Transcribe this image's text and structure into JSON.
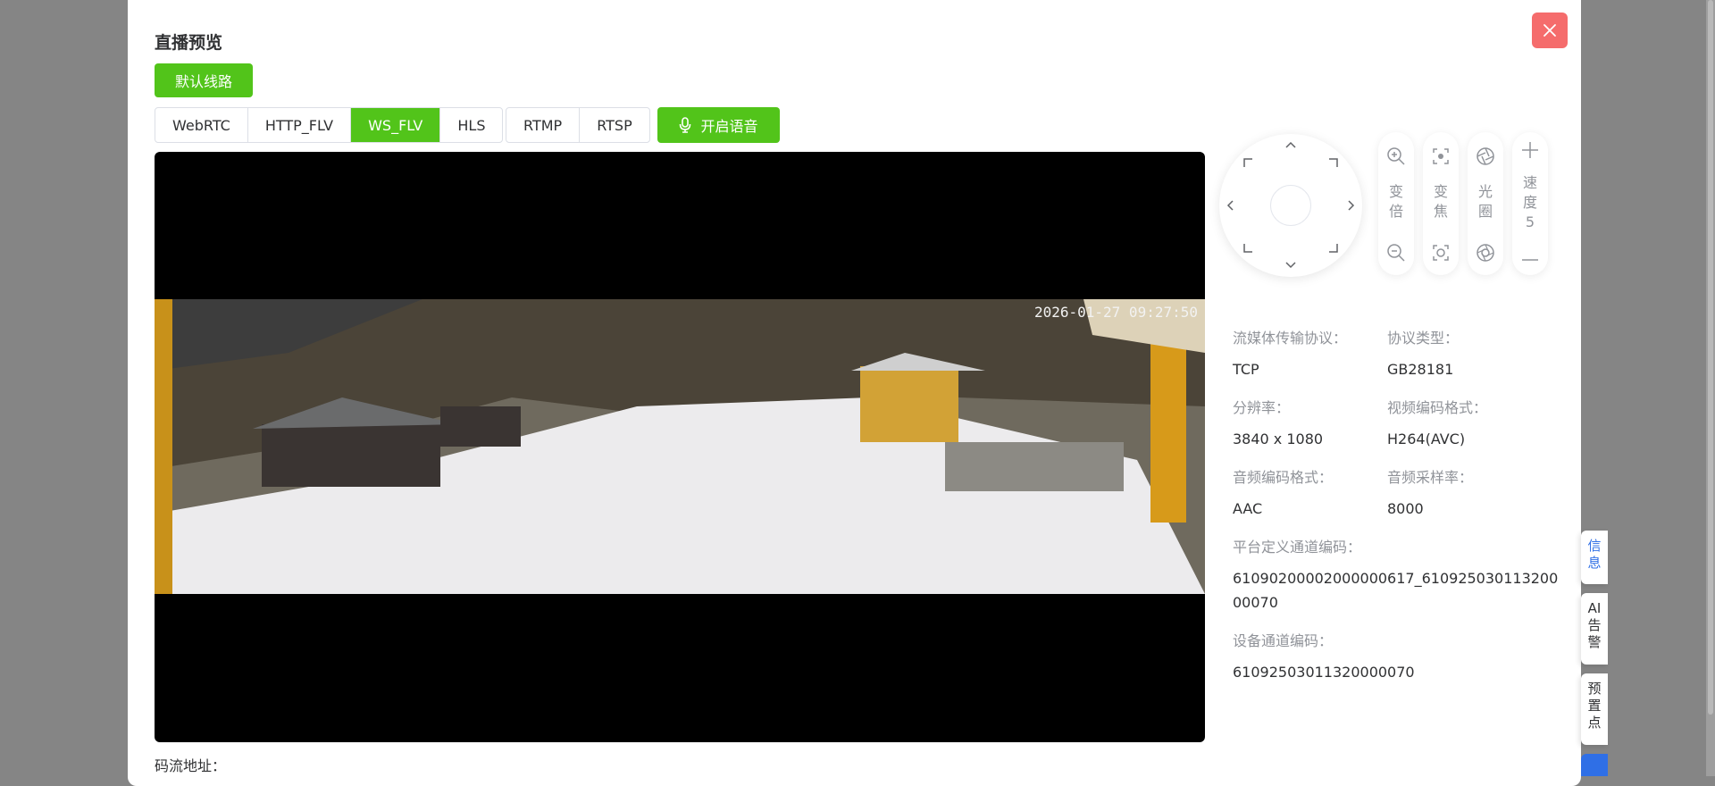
{
  "dialog": {
    "title": "直播预览"
  },
  "route": {
    "label": "默认线路"
  },
  "protocols": [
    {
      "label": "WebRTC",
      "active": false
    },
    {
      "label": "HTTP_FLV",
      "active": false
    },
    {
      "label": "WS_FLV",
      "active": true
    },
    {
      "label": "HLS",
      "active": false
    }
  ],
  "protocols2": [
    {
      "label": "RTMP"
    },
    {
      "label": "RTSP"
    }
  ],
  "voice": {
    "label": "开启语音",
    "icon": "microphone-icon"
  },
  "video": {
    "timestamp": "2026-01-27 09:27:50"
  },
  "stream_address_label": "码流地址：",
  "ptz": {
    "zoom_label": "变倍",
    "focus_label": "变焦",
    "iris_label": "光圈",
    "speed_label": "速度",
    "speed_value": "5"
  },
  "info": {
    "transport_key": "流媒体传输协议：",
    "transport_val": "TCP",
    "protocol_key": "协议类型：",
    "protocol_val": "GB28181",
    "resolution_key": "分辨率：",
    "resolution_val": "3840 x 1080",
    "vcodec_key": "视频编码格式：",
    "vcodec_val": "H264(AVC)",
    "acodec_key": "音频编码格式：",
    "acodec_val": "AAC",
    "samplerate_key": "音频采样率：",
    "samplerate_val": "8000",
    "platform_key": "平台定义通道编码：",
    "platform_val_1": "61090200002000000617_610925030113200",
    "platform_val_2": "00070",
    "device_key": "设备通道编码：",
    "device_val": "61092503011320000070"
  },
  "side_tabs": [
    {
      "label": "信息",
      "active": true
    },
    {
      "label": "AI告警",
      "active": false
    },
    {
      "label": "预置点",
      "active": false
    }
  ],
  "colors": {
    "primary": "#52c41a",
    "close": "#f56c6c",
    "active_tab": "#2f6fe6"
  }
}
